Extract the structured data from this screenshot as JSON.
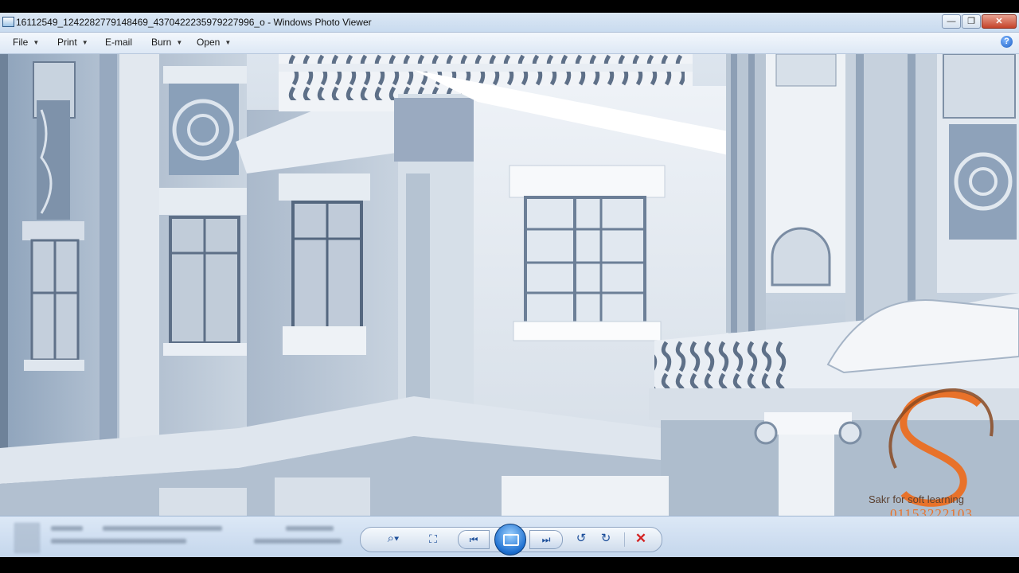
{
  "window": {
    "title": "16112549_1242282779148469_4370422235979227996_o - Windows Photo Viewer",
    "controls": {
      "minimize": "—",
      "maximize": "❐",
      "close": "✕"
    }
  },
  "menu": {
    "items": [
      {
        "label": "File"
      },
      {
        "label": "Print"
      },
      {
        "label": "E-mail"
      },
      {
        "label": "Burn"
      },
      {
        "label": "Open"
      }
    ],
    "help_glyph": "?"
  },
  "viewer": {
    "image_subject": "3D render of classical building facade with balustrades and carved panels"
  },
  "toolbar": {
    "zoom_glyph": "⌕▾",
    "fit_glyph": "⛶",
    "prev_glyph": "⏮",
    "next_glyph": "⏭",
    "rotate_left_glyph": "↺",
    "rotate_right_glyph": "↻",
    "delete_glyph": "✕"
  },
  "watermark": {
    "text": "Sakr for soft learning",
    "number": "01153222103",
    "colors": {
      "orange": "#e8722a",
      "dark": "#5a4030"
    }
  },
  "colors": {
    "titlebar": "#c9dbef",
    "facade": "#dde5ee",
    "shadow": "#9fb1c6"
  }
}
